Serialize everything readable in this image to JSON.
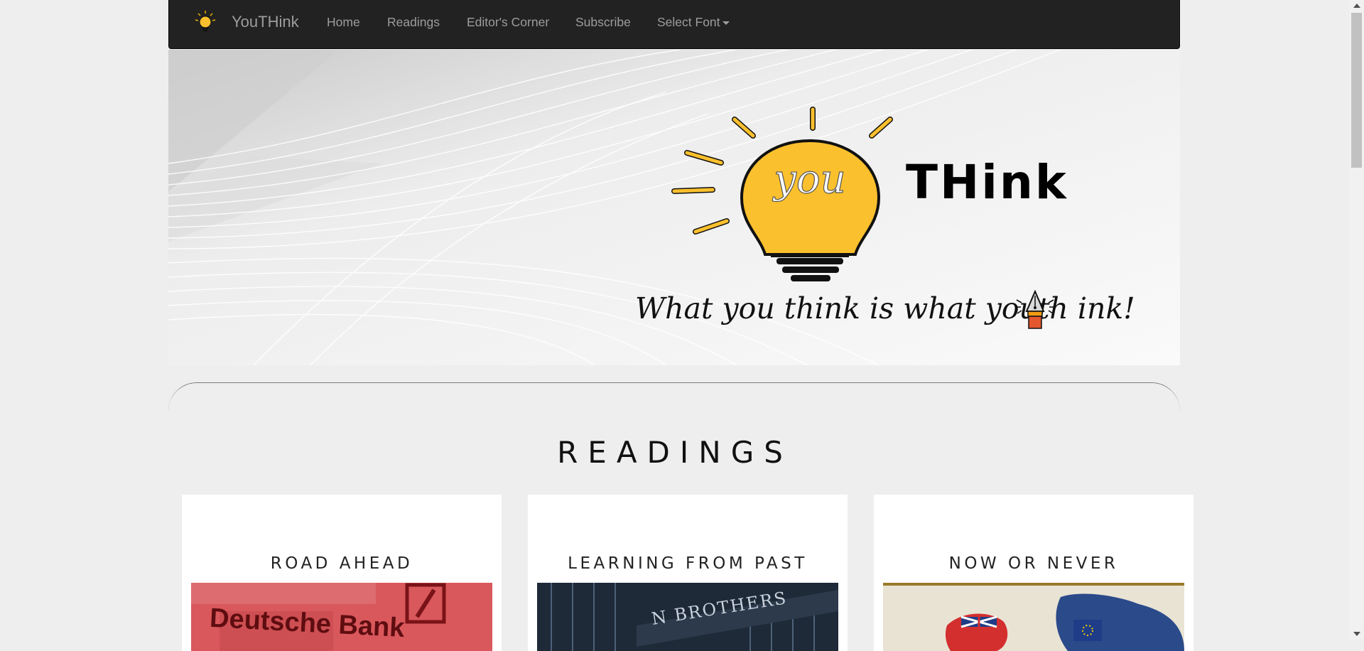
{
  "navbar": {
    "brand": "YouTHink",
    "items": [
      {
        "label": "Home"
      },
      {
        "label": "Readings"
      },
      {
        "label": "Editor's Corner"
      },
      {
        "label": "Subscribe"
      },
      {
        "label": "Select Font"
      }
    ]
  },
  "hero": {
    "logo_word_1": "you",
    "logo_word_2": "THink",
    "tagline": "What you think is what youth ink!"
  },
  "readings": {
    "title": "READINGS",
    "cards": [
      {
        "title": "ROAD AHEAD",
        "image_text": "Deutsche Bank"
      },
      {
        "title": "LEARNING FROM PAST",
        "image_text": "N BROTHERS"
      },
      {
        "title": "NOW OR NEVER",
        "image_text": ""
      }
    ]
  },
  "colors": {
    "navbar_bg": "#222222",
    "nav_text": "#9d9d9d",
    "bulb_yellow": "#fbc02d",
    "page_bg": "#eeeeee"
  },
  "icons": [
    "lightbulb-icon",
    "fountain-pen-icon",
    "caret-down-icon"
  ]
}
